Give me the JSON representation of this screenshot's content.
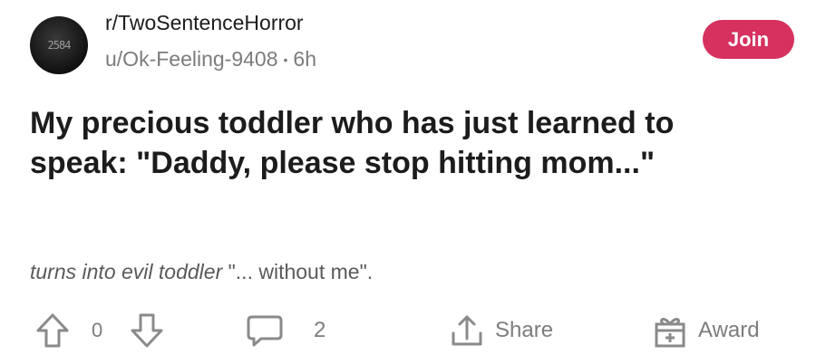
{
  "header": {
    "avatar_text": "2584",
    "subreddit": "r/TwoSentenceHorror",
    "author": "u/Ok-Feeling-9408",
    "separator": "•",
    "age": "6h",
    "join_label": "Join"
  },
  "post": {
    "title": "My precious toddler who has just learned to speak: \"Daddy, please stop hitting mom...\"",
    "body_italic": "turns into evil toddler",
    "body_rest": " \"... without me\"."
  },
  "actions": {
    "vote_count": "0",
    "comment_count": "2",
    "share_label": "Share",
    "award_label": "Award"
  },
  "colors": {
    "accent": "#d6315f",
    "muted": "#7c7c7c"
  }
}
